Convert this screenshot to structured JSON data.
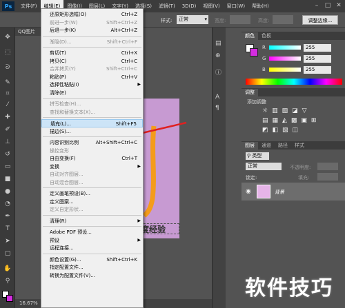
{
  "app": {
    "logo": "Ps"
  },
  "menubar": {
    "items": [
      "文件(F)",
      "编辑(E)",
      "图像(I)",
      "图层(L)",
      "文字(Y)",
      "选择(S)",
      "滤镜(T)",
      "3D(D)",
      "视图(V)",
      "窗口(W)",
      "帮助(H)"
    ],
    "active_index": 1
  },
  "optbar": {
    "style_label": "样式:",
    "style_value": "正常",
    "width_label": "宽度:",
    "height_label": "高度:",
    "refine_edge": "调整边缘..."
  },
  "document": {
    "tab_title": "QQ图片",
    "canvas_text": "度经验",
    "zoom": "16.67%",
    "artboard_color": "#c79ad2"
  },
  "edit_menu": [
    {
      "label": "还原矩形选框(O)",
      "shortcut": "Ctrl+Z",
      "disabled": false
    },
    {
      "label": "前进一步(W)",
      "shortcut": "Shift+Ctrl+Z",
      "disabled": true
    },
    {
      "label": "后退一步(K)",
      "shortcut": "Alt+Ctrl+Z",
      "disabled": false
    },
    {
      "sep": true
    },
    {
      "label": "渐隐(D)...",
      "shortcut": "Shift+Ctrl+F",
      "disabled": true
    },
    {
      "sep": true
    },
    {
      "label": "剪切(T)",
      "shortcut": "Ctrl+X",
      "disabled": false
    },
    {
      "label": "拷贝(C)",
      "shortcut": "Ctrl+C",
      "disabled": false
    },
    {
      "label": "合并拷贝(Y)",
      "shortcut": "Shift+Ctrl+C",
      "disabled": true
    },
    {
      "label": "粘贴(P)",
      "shortcut": "Ctrl+V",
      "disabled": false
    },
    {
      "label": "选择性粘贴(I)",
      "shortcut": "",
      "submenu": true,
      "disabled": false
    },
    {
      "label": "清除(E)",
      "shortcut": "",
      "disabled": false
    },
    {
      "sep": true
    },
    {
      "label": "拼写检查(H)...",
      "shortcut": "",
      "disabled": true
    },
    {
      "label": "查找和替换文本(X)...",
      "shortcut": "",
      "disabled": true
    },
    {
      "sep": true
    },
    {
      "label": "填充(L)...",
      "shortcut": "Shift+F5",
      "disabled": false,
      "highlight": true
    },
    {
      "label": "描边(S)...",
      "shortcut": "",
      "disabled": false
    },
    {
      "sep": true
    },
    {
      "label": "内容识别比例",
      "shortcut": "Alt+Shift+Ctrl+C",
      "disabled": false
    },
    {
      "label": "操控变形",
      "shortcut": "",
      "disabled": true
    },
    {
      "label": "自由变换(F)",
      "shortcut": "Ctrl+T",
      "disabled": false
    },
    {
      "label": "变换",
      "shortcut": "",
      "submenu": true,
      "disabled": false
    },
    {
      "label": "自动对齐图层...",
      "shortcut": "",
      "disabled": true
    },
    {
      "label": "自动混合图层...",
      "shortcut": "",
      "disabled": true
    },
    {
      "sep": true
    },
    {
      "label": "定义画笔预设(B)...",
      "shortcut": "",
      "disabled": false
    },
    {
      "label": "定义图案...",
      "shortcut": "",
      "disabled": false
    },
    {
      "label": "定义自定形状...",
      "shortcut": "",
      "disabled": true
    },
    {
      "sep": true
    },
    {
      "label": "清理(R)",
      "shortcut": "",
      "submenu": true,
      "disabled": false
    },
    {
      "sep": true
    },
    {
      "label": "Adobe PDF 预设...",
      "shortcut": "",
      "disabled": false
    },
    {
      "label": "预设",
      "shortcut": "",
      "submenu": true,
      "disabled": false
    },
    {
      "label": "远程连接...",
      "shortcut": "",
      "disabled": false
    },
    {
      "sep": true
    },
    {
      "label": "颜色设置(G)...",
      "shortcut": "Shift+Ctrl+K",
      "disabled": false
    },
    {
      "label": "指定配置文件...",
      "shortcut": "",
      "disabled": false
    },
    {
      "label": "转换为配置文件(V)...",
      "shortcut": "",
      "disabled": false
    }
  ],
  "color_panel": {
    "tabs": [
      "颜色",
      "色板"
    ],
    "channels": [
      {
        "name": "R",
        "value": "255"
      },
      {
        "name": "G",
        "value": "255"
      },
      {
        "name": "B",
        "value": "255"
      }
    ]
  },
  "adjust_panel": {
    "tabs": [
      "调整"
    ],
    "subtitle": "添加调整"
  },
  "layers_panel": {
    "tabs": [
      "图层",
      "通道",
      "路径",
      "样式"
    ],
    "kind_label": "类型",
    "blend_mode": "正常",
    "opacity_label": "不透明度:",
    "lock_label": "锁定:",
    "fill_label": "填充:",
    "layer_name": "背景"
  },
  "watermark": "软件技巧"
}
